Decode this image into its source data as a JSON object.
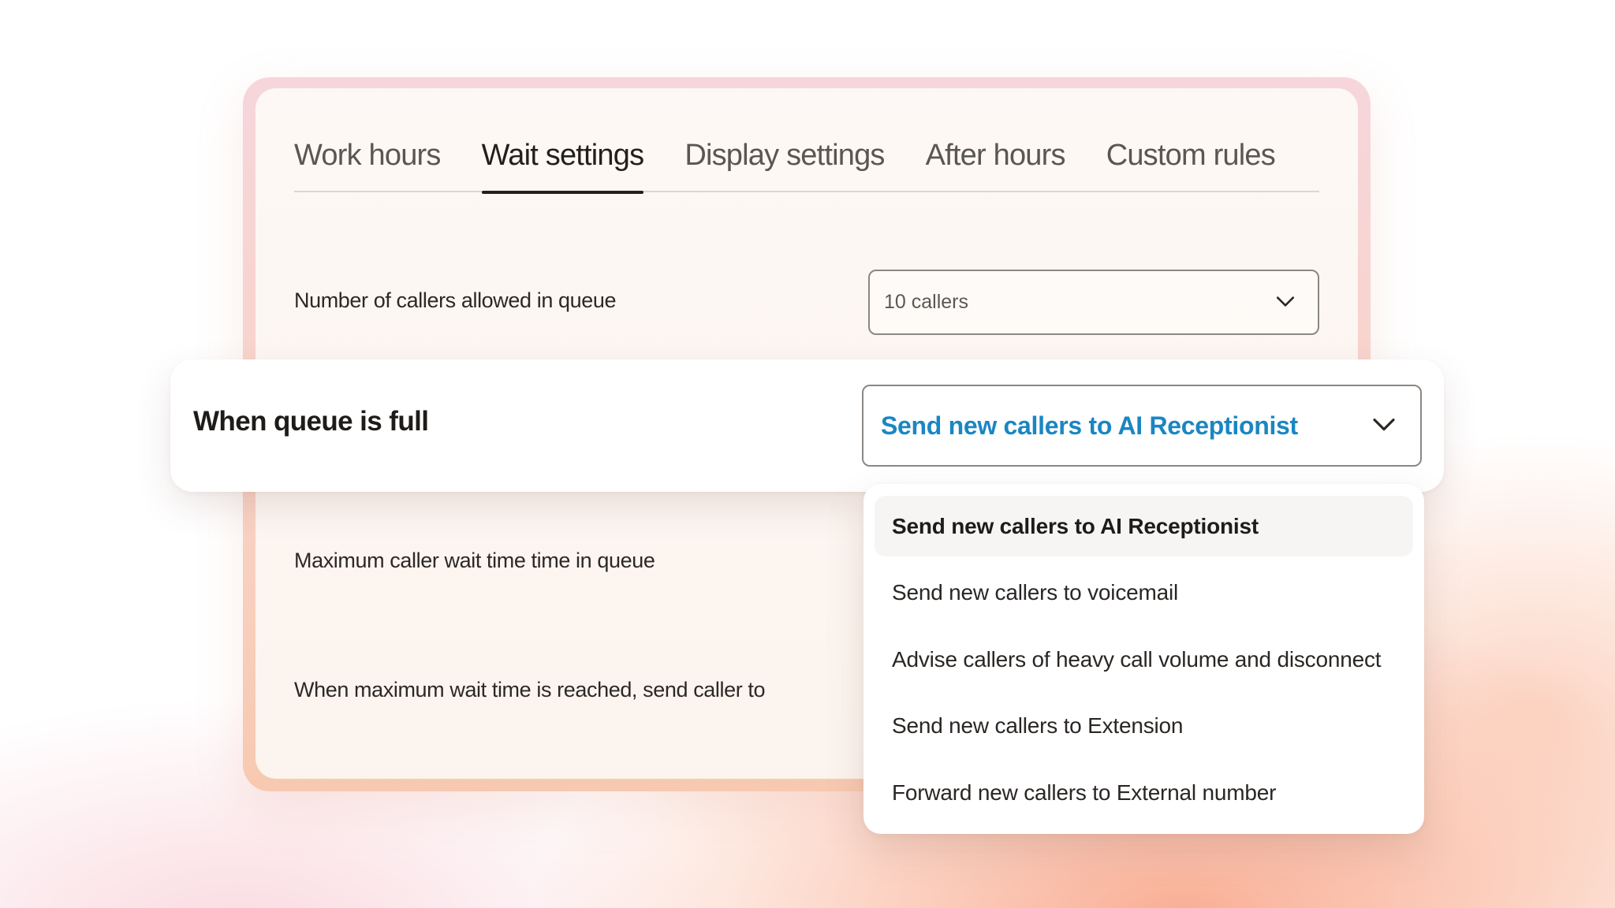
{
  "tabs": [
    {
      "label": "Work hours",
      "active": false
    },
    {
      "label": "Wait settings",
      "active": true
    },
    {
      "label": "Display settings",
      "active": false
    },
    {
      "label": "After hours",
      "active": false
    },
    {
      "label": "Custom rules",
      "active": false
    }
  ],
  "rows": {
    "callers_label": "Number of callers allowed in queue",
    "callers_value": "10 callers",
    "queue_full_label": "When queue is full",
    "queue_full_value": "Send new callers to AI Receptionist",
    "max_wait_label": "Maximum caller wait time time in queue",
    "max_wait_reached_label": "When maximum wait time is reached, send caller to"
  },
  "menu": {
    "items": [
      {
        "label": "Send new callers to AI Receptionist",
        "selected": true
      },
      {
        "label": "Send new callers to voicemail",
        "selected": false
      },
      {
        "label": "Advise callers of heavy call volume and disconnect",
        "selected": false
      },
      {
        "label": "Send new callers to Extension",
        "selected": false
      },
      {
        "label": "Forward new callers to External number",
        "selected": false
      }
    ]
  },
  "icons": {
    "select_chevron": "chevron-down-icon"
  },
  "colors": {
    "accent_text": "#1a86c2",
    "tab_active": "#231f1d",
    "tab_inactive": "#5b5653"
  }
}
